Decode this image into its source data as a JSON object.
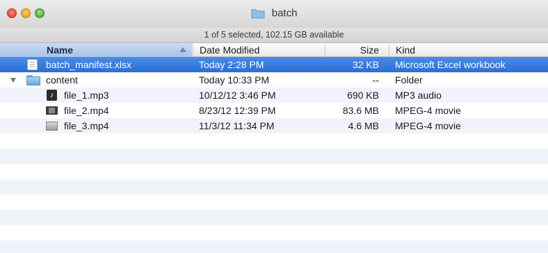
{
  "window": {
    "title": "batch",
    "status": "1 of 5 selected, 102.15 GB available"
  },
  "columns": {
    "name": "Name",
    "date": "Date Modified",
    "size": "Size",
    "kind": "Kind"
  },
  "files": [
    {
      "name": "batch_manifest.xlsx",
      "date": "Today 2:28 PM",
      "size": "32 KB",
      "kind": "Microsoft Excel workbook",
      "icon": "spreadsheet-document-icon",
      "selected": true
    },
    {
      "name": "content",
      "date": "Today 10:33 PM",
      "size": "--",
      "kind": "Folder",
      "icon": "folder-icon",
      "expanded": true
    },
    {
      "name": "file_1.mp3",
      "date": "10/12/12 3:46 PM",
      "size": "690 KB",
      "kind": "MP3 audio",
      "icon": "audio-file-icon"
    },
    {
      "name": "file_2.mp4",
      "date": "8/23/12 12:39 PM",
      "size": "83.6 MB",
      "kind": "MPEG-4 movie",
      "icon": "movie-file-icon"
    },
    {
      "name": "file_3.mp4",
      "date": "11/3/12 11:34 PM",
      "size": "4.6 MB",
      "kind": "MPEG-4 movie",
      "icon": "movie-file-icon"
    }
  ],
  "colors": {
    "selection": "#2b6fd6",
    "alternate_row": "#f0f4fa",
    "sorted_column_header": "#b3cbea"
  }
}
